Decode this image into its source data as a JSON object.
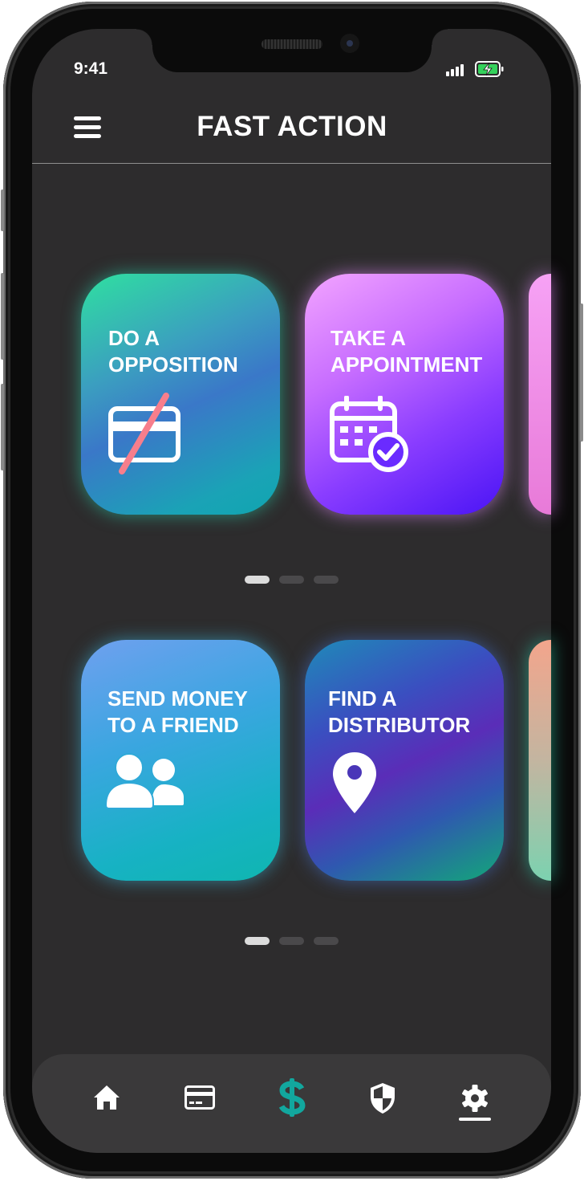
{
  "status_bar": {
    "time": "9:41"
  },
  "header": {
    "title": "FAST ACTION"
  },
  "carousel_1": {
    "cards": [
      {
        "line1": "DO A",
        "line2": "OPPOSITION",
        "icon": "blocked-card-icon"
      },
      {
        "line1": "TAKE A",
        "line2": "APPOINTMENT",
        "icon": "calendar-check-icon"
      }
    ],
    "page_count": 3,
    "active_page": 0
  },
  "carousel_2": {
    "cards": [
      {
        "line1": "SEND MONEY",
        "line2": "TO A FRIEND",
        "icon": "users-icon"
      },
      {
        "line1": "FIND A",
        "line2": "DISTRIBUTOR",
        "icon": "map-pin-icon"
      }
    ],
    "page_count": 3,
    "active_page": 0
  },
  "bottom_nav": {
    "items": [
      "home-icon",
      "credit-card-icon",
      "dollar-icon",
      "shield-icon",
      "settings-icon"
    ],
    "active": "dollar-icon",
    "accent_color": "#12a79e"
  }
}
